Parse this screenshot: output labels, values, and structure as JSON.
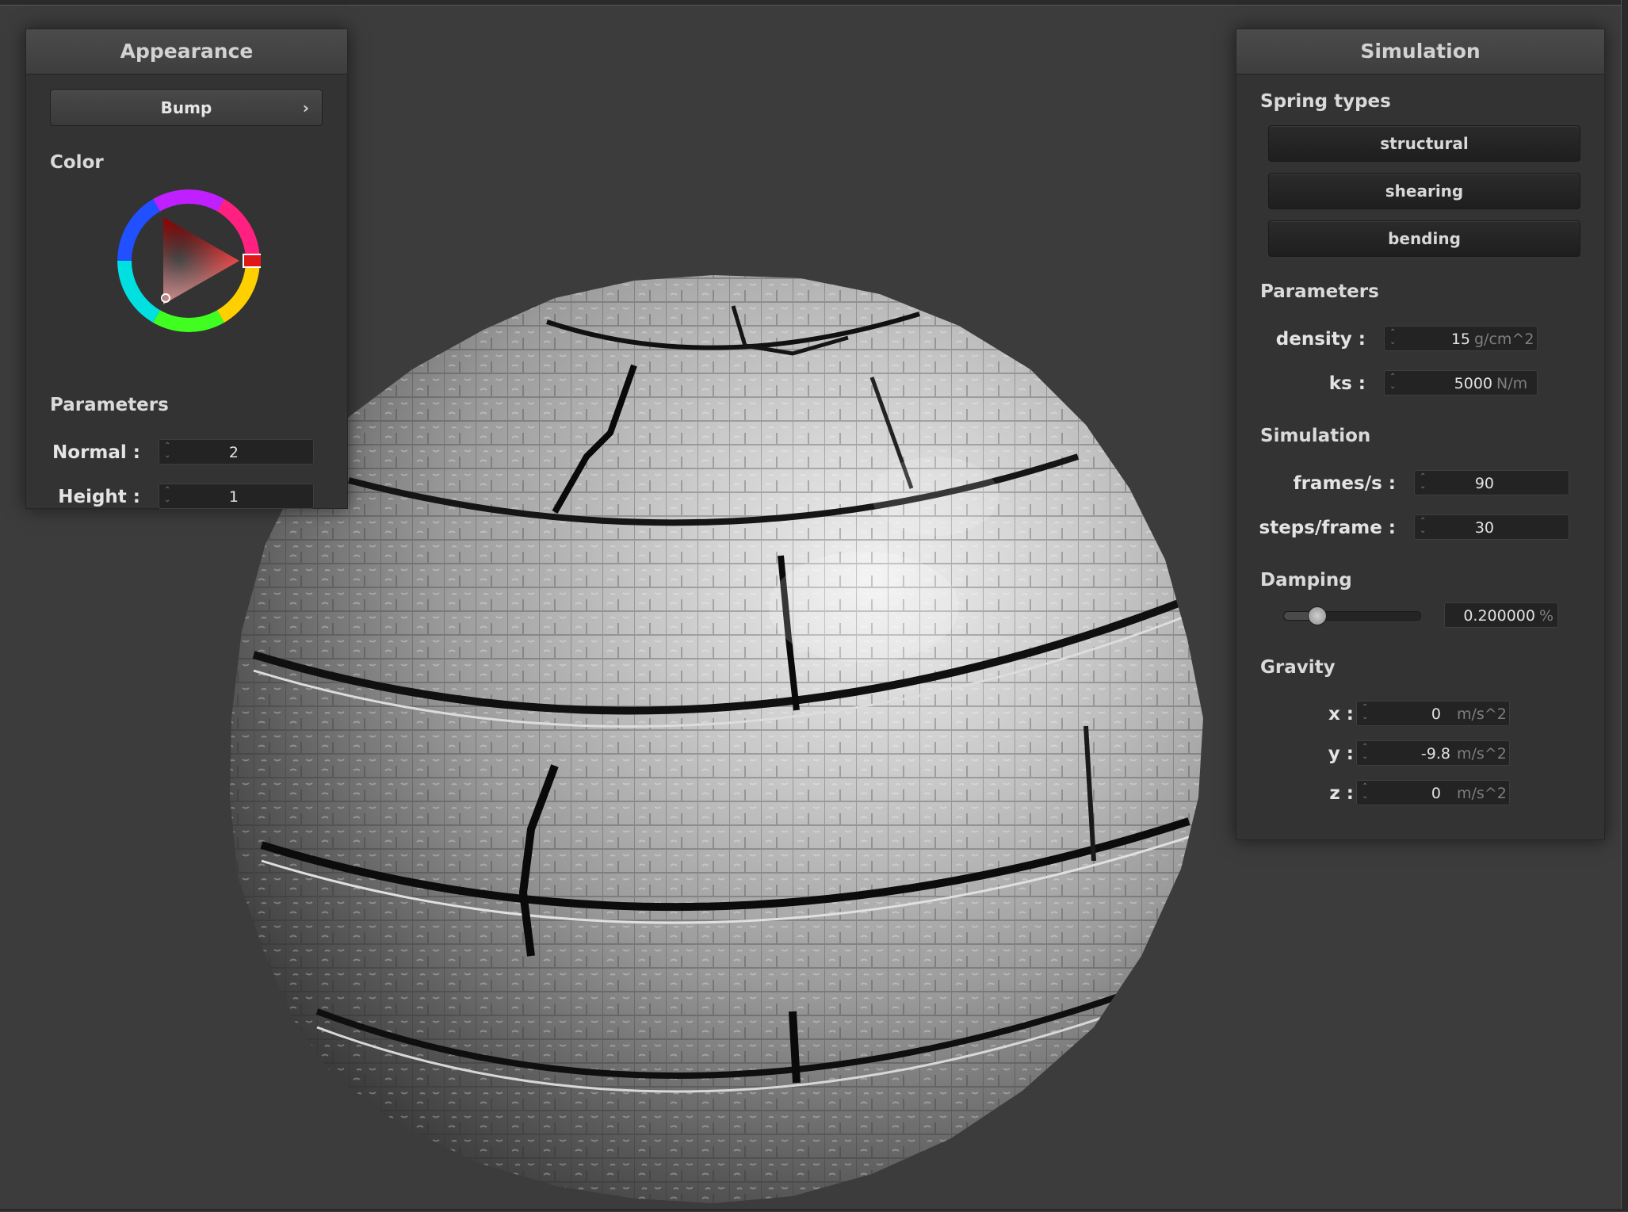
{
  "appearance": {
    "title": "Appearance",
    "shader_dropdown": "Bump",
    "shader_dropdown_chevron": "›",
    "color_label": "Color",
    "selected_color": "#ff0000",
    "parameters_label": "Parameters",
    "normal": {
      "label": "Normal :",
      "value": "2"
    },
    "height": {
      "label": "Height :",
      "value": "1"
    }
  },
  "simulation": {
    "title": "Simulation",
    "spring_types_label": "Spring types",
    "spring_buttons": [
      "structural",
      "shearing",
      "bending"
    ],
    "parameters_label": "Parameters",
    "density": {
      "label": "density :",
      "value": "15",
      "unit": "g/cm^2"
    },
    "ks": {
      "label": "ks :",
      "value": "5000",
      "unit": "N/m"
    },
    "simulation_label": "Simulation",
    "frames_per_s": {
      "label": "frames/s :",
      "value": "90"
    },
    "steps_per_frame": {
      "label": "steps/frame :",
      "value": "30"
    },
    "damping_label": "Damping",
    "damping": {
      "value": "0.200000",
      "unit": "%",
      "slider_fraction": 0.2
    },
    "gravity_label": "Gravity",
    "gravity": [
      {
        "label": "x :",
        "value": "0",
        "unit": "m/s^2"
      },
      {
        "label": "y :",
        "value": "-9.8",
        "unit": "m/s^2"
      },
      {
        "label": "z :",
        "value": "0",
        "unit": "m/s^2"
      }
    ]
  },
  "icons": {
    "spin_arrows": "⌃⌄",
    "viewport_object": "bump-mapped-sphere"
  }
}
